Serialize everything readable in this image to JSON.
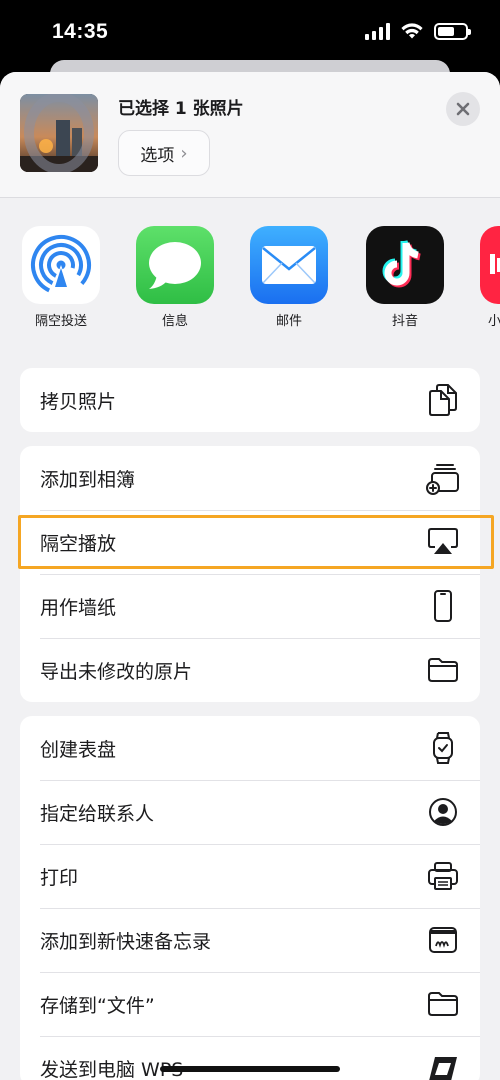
{
  "status_bar": {
    "time": "14:35"
  },
  "sheet_header": {
    "title": "已选择 1 张照片",
    "options_label": "选项",
    "close_icon": "close-icon"
  },
  "apps": [
    {
      "label": "隔空投送",
      "icon": "airdrop-icon",
      "color": "#2f86f0"
    },
    {
      "label": "信息",
      "icon": "messages-icon",
      "color": "#34c759"
    },
    {
      "label": "邮件",
      "icon": "mail-icon",
      "color": "#2a8cf5"
    },
    {
      "label": "抖音",
      "icon": "douyin-icon",
      "color": "#111111"
    },
    {
      "label": "小",
      "icon": "xiaohongshu-icon",
      "color": "#ff2442"
    }
  ],
  "groups": [
    {
      "rows": [
        {
          "label": "拷贝照片",
          "icon": "copy-icon"
        }
      ]
    },
    {
      "rows": [
        {
          "label": "添加到相簿",
          "icon": "add-to-album-icon"
        },
        {
          "label": "隔空播放",
          "icon": "airplay-icon"
        },
        {
          "label": "用作墙纸",
          "icon": "phone-wallpaper-icon",
          "highlighted": true
        },
        {
          "label": "导出未修改的原片",
          "icon": "folder-icon"
        }
      ]
    },
    {
      "rows": [
        {
          "label": "创建表盘",
          "icon": "watch-icon"
        },
        {
          "label": "指定给联系人",
          "icon": "contact-icon"
        },
        {
          "label": "打印",
          "icon": "printer-icon"
        },
        {
          "label": "添加到新快速备忘录",
          "icon": "quick-note-icon"
        },
        {
          "label": "存储到“文件”",
          "icon": "folder-icon"
        },
        {
          "label": "发送到电脑 WPS",
          "icon": "wps-icon"
        }
      ]
    }
  ],
  "colors": {
    "highlight_border": "#f5a623",
    "sheet_background": "#f1f1f3"
  }
}
